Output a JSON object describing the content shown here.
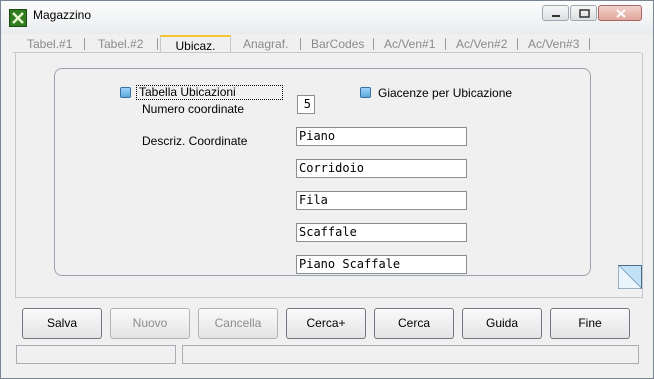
{
  "window": {
    "title": "Magazzino",
    "accent": "#f5c431"
  },
  "tabs": [
    {
      "label": "Tabel.#1",
      "active": false
    },
    {
      "label": "Tabel.#2",
      "active": false
    },
    {
      "label": "Ubicaz.",
      "active": true
    },
    {
      "label": "Anagraf.",
      "active": false
    },
    {
      "label": "BarCodes",
      "active": false
    },
    {
      "label": "Ac/Ven#1",
      "active": false
    },
    {
      "label": "Ac/Ven#2",
      "active": false
    },
    {
      "label": "Ac/Ven#3",
      "active": false
    }
  ],
  "form": {
    "tabella_ubicazioni_label": "Tabella Ubicazioni",
    "giacenze_label": "Giacenze per Ubicazione",
    "numero_coordinate_label": "Numero coordinate",
    "numero_coordinate_value": "5",
    "descriz_coordinate_label": "Descriz. Coordinate",
    "coordinates": [
      "Piano",
      "Corridoio",
      "Fila",
      "Scaffale",
      "Piano Scaffale"
    ]
  },
  "buttons": {
    "salva": "Salva",
    "nuovo": "Nuovo",
    "cancella": "Cancella",
    "cerca_plus": "Cerca+",
    "cerca": "Cerca",
    "guida": "Guida",
    "fine": "Fine"
  }
}
